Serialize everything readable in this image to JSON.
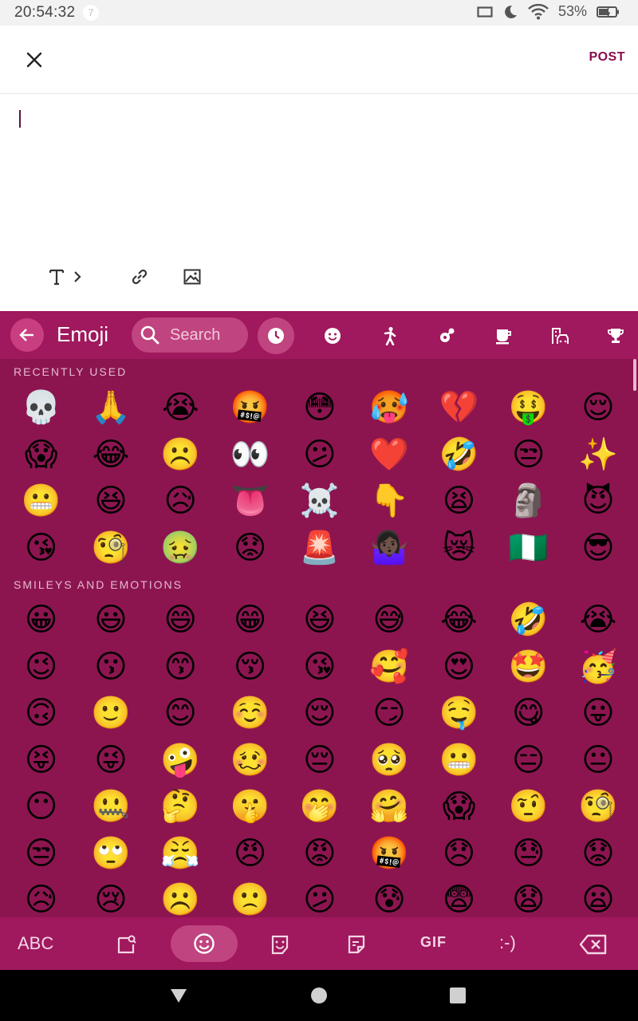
{
  "status_bar": {
    "time": "20:54:32",
    "notification_badge": "7",
    "battery_percent": "53%"
  },
  "app_bar": {
    "post_label": "POST"
  },
  "keyboard": {
    "title": "Emoji",
    "search_placeholder": "Search",
    "sections": {
      "recent_label": "RECENTLY USED",
      "smileys_label": "SMILEYS AND EMOTIONS"
    },
    "recent_emojis": [
      "💀",
      "🙏",
      "😭",
      "🤬",
      "😳",
      "🥵",
      "💔",
      "🤑",
      "😌",
      "😱",
      "😂",
      "☹️",
      "👀",
      "😕",
      "❤️",
      "🤣",
      "😒",
      "✨",
      "😬",
      "😆",
      "😥",
      "👅",
      "☠️",
      "👇",
      "😫",
      "🗿",
      "😈",
      "😘",
      "🧐",
      "🤢",
      "😟",
      "🚨",
      "🤷🏿‍♀️",
      "😿",
      "🇳🇬",
      "😎"
    ],
    "smiley_emojis": [
      "😀",
      "😃",
      "😄",
      "😁",
      "😆",
      "😅",
      "😂",
      "🤣",
      "😭",
      "😉",
      "😗",
      "😙",
      "😚",
      "😘",
      "🥰",
      "😍",
      "🤩",
      "🥳",
      "🙃",
      "🙂",
      "😊",
      "☺️",
      "😌",
      "😏",
      "🤤",
      "😋",
      "😛",
      "😝",
      "😜",
      "🤪",
      "🥴",
      "😔",
      "🥺",
      "😬",
      "😑",
      "😐",
      "😶",
      "🤐",
      "🤔",
      "🤫",
      "🤭",
      "🤗",
      "😱",
      "🤨",
      "🧐",
      "😒",
      "🙄",
      "😤",
      "😠",
      "😡",
      "🤬",
      "😞",
      "😓",
      "😟",
      "😥",
      "😢",
      "☹️",
      "🙁",
      "😕",
      "😰",
      "😨",
      "😧",
      "😦"
    ],
    "bottom": {
      "abc_label": "ABC",
      "gif_label": "GIF",
      "emoticon_label": ":-)"
    }
  },
  "colors": {
    "accent": "#8b0b4c",
    "keyboard_bg": "#8c1550",
    "keyboard_bar": "#a0185e",
    "chip": "#c0447f"
  }
}
